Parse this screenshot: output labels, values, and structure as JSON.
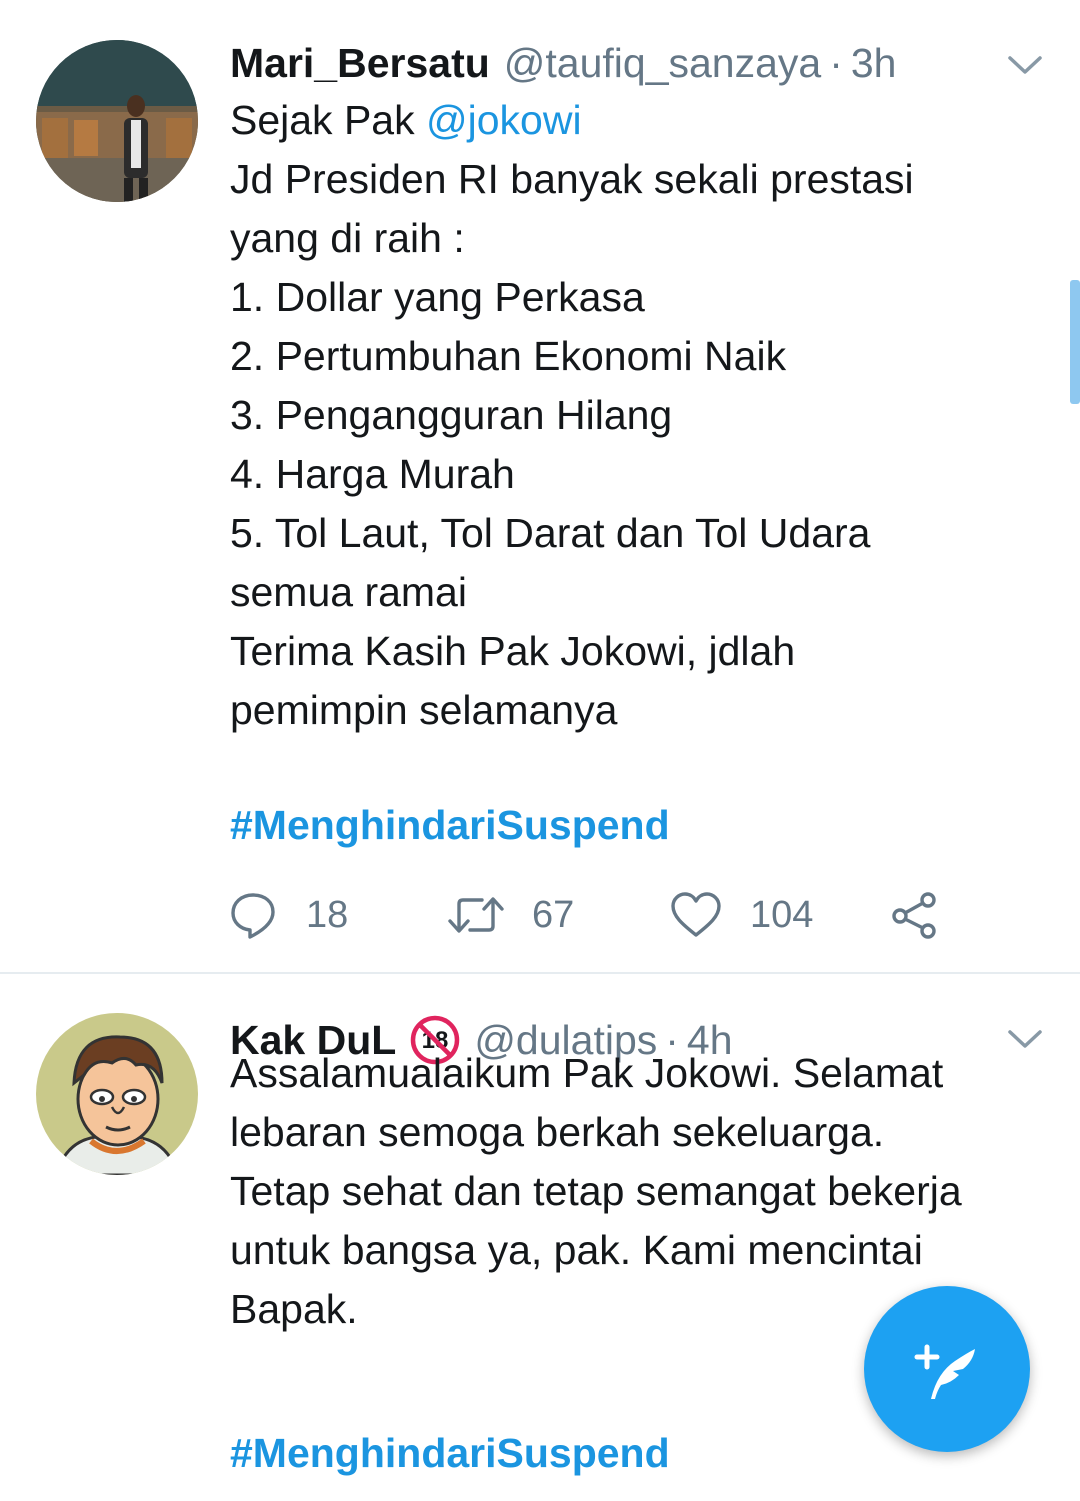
{
  "tweets": [
    {
      "name": "Mari_Bersatu",
      "handle": "@taufiq_sanzaya",
      "separator": "·",
      "time": "3h",
      "text_prefix": "Sejak Pak ",
      "mention": "@jokowi",
      "text_rest": "\nJd Presiden RI banyak sekali prestasi\nyang di raih :\n1. Dollar yang Perkasa\n2. Pertumbuhan Ekonomi Naik\n3. Pengangguran Hilang\n4. Harga Murah\n5. Tol Laut, Tol Darat dan Tol Udara\nsemua ramai\nTerima Kasih Pak Jokowi, jdlah\npemimpin selamanya",
      "hashtag": "#MenghindariSuspend",
      "replies": "18",
      "retweets": "67",
      "likes": "104"
    },
    {
      "name": "Kak DuL",
      "badge": "18",
      "handle": "@dulatips",
      "separator": "·",
      "time": "4h",
      "text": "Assalamualaikum Pak Jokowi. Selamat\nlebaran semoga berkah sekeluarga.\nTetap sehat dan tetap semangat bekerja\nuntuk bangsa ya, pak. Kami mencintai\nBapak.",
      "hashtag": "#MenghindariSuspend"
    }
  ],
  "icons": {
    "reply": "reply-icon",
    "retweet": "retweet-icon",
    "like": "heart-icon",
    "share": "share-icon",
    "more": "chevron-down-icon",
    "compose": "compose-tweet-icon"
  },
  "colors": {
    "link": "#1b95e0",
    "secondary_text": "#657786",
    "fab": "#1da1f2"
  }
}
